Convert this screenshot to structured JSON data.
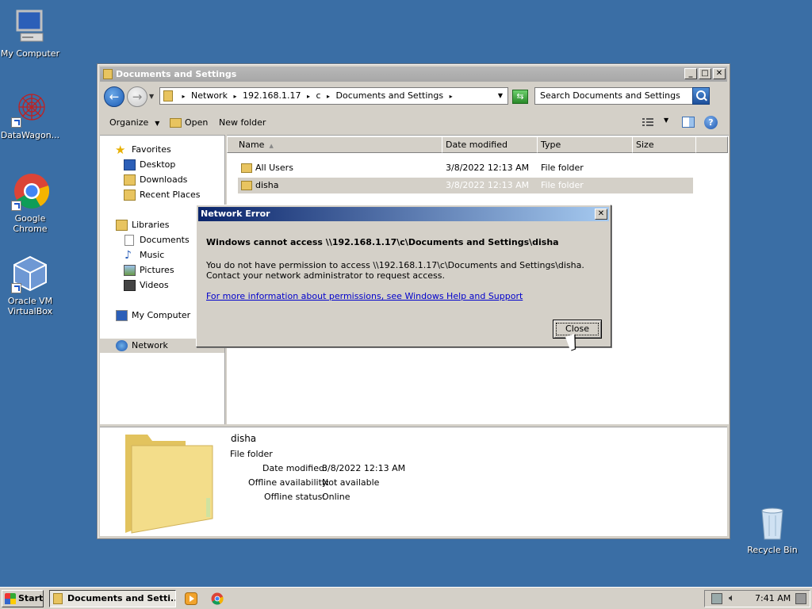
{
  "desktop": {
    "icons": [
      {
        "label": "My Computer"
      },
      {
        "label": "DataWagon..."
      },
      {
        "label": "Google Chrome"
      },
      {
        "label": "Oracle VM\nVirtualBox"
      },
      {
        "label": "Recycle Bin"
      }
    ]
  },
  "explorer": {
    "title": "Documents and Settings",
    "address": {
      "segments": [
        "Network",
        "192.168.1.17",
        "c",
        "Documents and Settings"
      ]
    },
    "search": {
      "placeholder": "Search Documents and Settings"
    },
    "toolbar": {
      "organize": "Organize",
      "open": "Open",
      "new_folder": "New folder"
    },
    "nav": {
      "favorites": "Favorites",
      "desktop": "Desktop",
      "downloads": "Downloads",
      "recent_places": "Recent Places",
      "libraries": "Libraries",
      "documents": "Documents",
      "music": "Music",
      "pictures": "Pictures",
      "videos": "Videos",
      "my_computer": "My Computer",
      "network": "Network"
    },
    "columns": {
      "name": "Name",
      "date_modified": "Date modified",
      "type": "Type",
      "size": "Size"
    },
    "rows": [
      {
        "name": "All Users",
        "date": "3/8/2022 12:13 AM",
        "type": "File folder"
      },
      {
        "name": "disha",
        "date": "3/8/2022 12:13 AM",
        "type": "File folder"
      }
    ],
    "details": {
      "name": "disha",
      "kind": "File folder",
      "date_label": "Date modified:",
      "date_value": "3/8/2022 12:13 AM",
      "offline_avail_label": "Offline availability:",
      "offline_avail_value": "Not available",
      "offline_status_label": "Offline status:",
      "offline_status_value": "Online"
    }
  },
  "dialog": {
    "title": "Network Error",
    "heading": "Windows cannot access \\\\192.168.1.17\\c\\Documents and Settings\\disha",
    "body": "You do not have permission to access \\\\192.168.1.17\\c\\Documents and Settings\\disha. Contact your network administrator to request access.",
    "link": "For more information about permissions, see Windows Help and Support",
    "close_label": "Close"
  },
  "taskbar": {
    "start": "Start",
    "task": "Documents and Setti...",
    "time": "7:41 AM"
  }
}
